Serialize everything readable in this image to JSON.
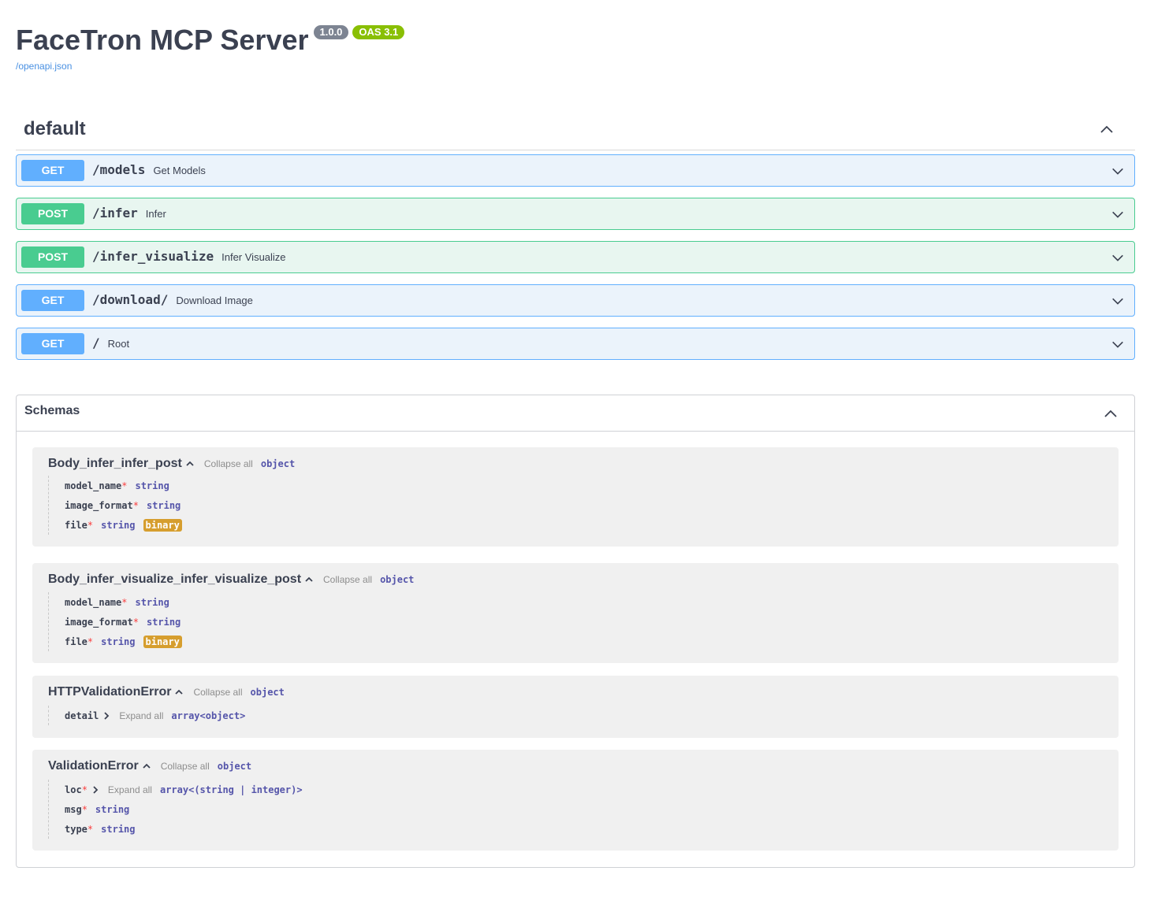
{
  "info": {
    "title": "FaceTron MCP Server",
    "version": "1.0.0",
    "oas": "OAS 3.1",
    "spec_link": "/openapi.json"
  },
  "tag": {
    "name": "default"
  },
  "operations": [
    {
      "method": "GET",
      "path": "/models",
      "summary": "Get Models"
    },
    {
      "method": "POST",
      "path": "/infer",
      "summary": "Infer"
    },
    {
      "method": "POST",
      "path": "/infer_visualize",
      "summary": "Infer Visualize"
    },
    {
      "method": "GET",
      "path": "/download/",
      "summary": "Download Image"
    },
    {
      "method": "GET",
      "path": "/",
      "summary": "Root"
    }
  ],
  "schemas": {
    "title": "Schemas",
    "collapse_label": "Collapse all",
    "expand_label": "Expand all",
    "models": [
      {
        "name": "Body_infer_infer_post",
        "type": "object",
        "props": [
          {
            "name": "model_name",
            "required": "*",
            "type": "string"
          },
          {
            "name": "image_format",
            "required": "*",
            "type": "string"
          },
          {
            "name": "file",
            "required": "*",
            "type": "string",
            "format": "binary"
          }
        ]
      },
      {
        "name": "Body_infer_visualize_infer_visualize_post",
        "type": "object",
        "props": [
          {
            "name": "model_name",
            "required": "*",
            "type": "string"
          },
          {
            "name": "image_format",
            "required": "*",
            "type": "string"
          },
          {
            "name": "file",
            "required": "*",
            "type": "string",
            "format": "binary"
          }
        ]
      },
      {
        "name": "HTTPValidationError",
        "type": "object",
        "props": [
          {
            "name": "detail",
            "type": "array<object>"
          }
        ]
      },
      {
        "name": "ValidationError",
        "type": "object",
        "props": [
          {
            "name": "loc",
            "required": "*",
            "type": "array<(string | integer)>"
          },
          {
            "name": "msg",
            "required": "*",
            "type": "string"
          },
          {
            "name": "type",
            "required": "*",
            "type": "string"
          }
        ]
      }
    ]
  },
  "icons": {
    "collapse": "chevron-up-icon",
    "expand": "chevron-down-icon",
    "model_caret": "caret-up-icon",
    "prop_caret": "caret-right-icon"
  },
  "colors": {
    "get": "#61affe",
    "post": "#49cc90",
    "binary_badge": "#d69e2e",
    "required": "#f93e3e",
    "type": "#5555aa"
  }
}
